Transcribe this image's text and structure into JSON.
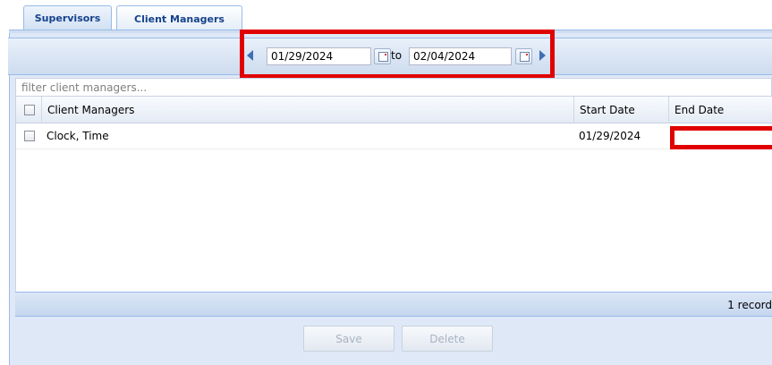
{
  "tabs": [
    {
      "label": "Supervisors",
      "active": false
    },
    {
      "label": "Client Managers",
      "active": true
    }
  ],
  "toolbar": {
    "start_date": "01/29/2024",
    "to_label": "to",
    "end_date": "02/04/2024"
  },
  "filter": {
    "placeholder": "filter client managers..."
  },
  "grid": {
    "columns": [
      "Client Managers",
      "Start Date",
      "End Date"
    ],
    "rows": [
      {
        "name": "Clock, Time",
        "start_date": "01/29/2024",
        "end_date": ""
      }
    ]
  },
  "pager": {
    "text": "1 record"
  },
  "buttons": {
    "save": "Save",
    "delete": "Delete"
  },
  "colors": {
    "accent_border": "#99bbe8",
    "tab_text": "#15428b",
    "highlight": "#e00000"
  }
}
